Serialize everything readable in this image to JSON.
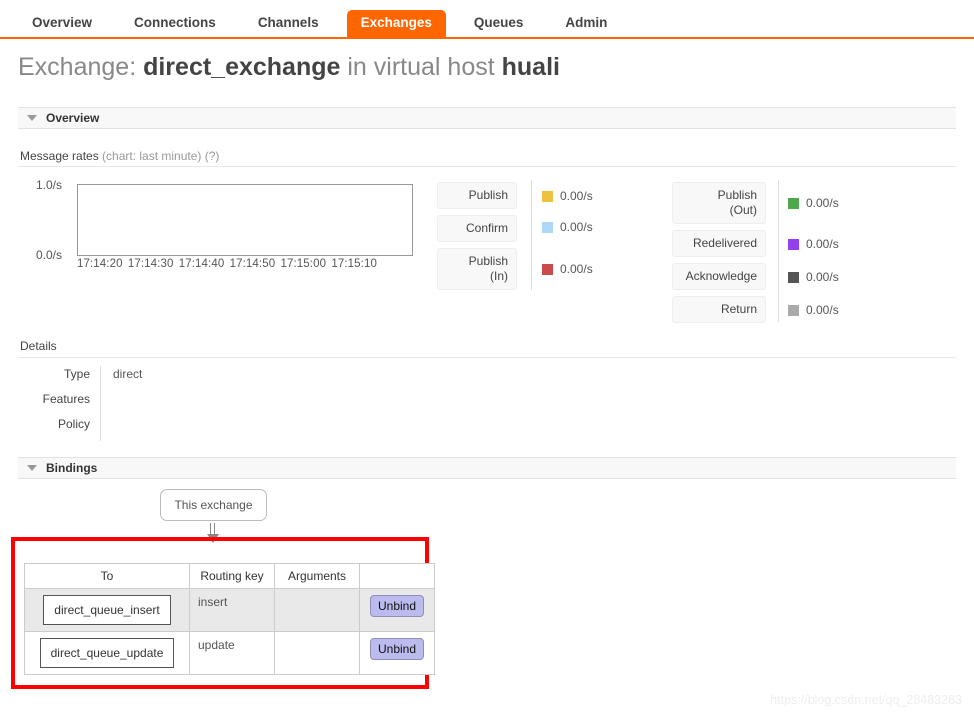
{
  "nav": {
    "items": [
      {
        "id": "overview",
        "label": "Overview",
        "active": false
      },
      {
        "id": "connections",
        "label": "Connections",
        "active": false
      },
      {
        "id": "channels",
        "label": "Channels",
        "active": false
      },
      {
        "id": "exchanges",
        "label": "Exchanges",
        "active": true
      },
      {
        "id": "queues",
        "label": "Queues",
        "active": false
      },
      {
        "id": "admin",
        "label": "Admin",
        "active": false
      }
    ],
    "accent_color": "#ff6600"
  },
  "page": {
    "title_prefix": "Exchange:",
    "exchange_name": "direct_exchange",
    "title_middle": "in virtual host",
    "vhost": "huali"
  },
  "overview_section": {
    "label": "Overview",
    "caret": "caret-down-icon",
    "message_rates_label": "Message rates",
    "message_rates_note": "(chart: last minute) (?)"
  },
  "chart_data": {
    "type": "line",
    "title": "Message rates (chart: last minute)",
    "xlabel": "",
    "ylabel": "",
    "ylim": [
      0.0,
      1.0
    ],
    "ytick_labels": [
      "1.0/s",
      "0.0/s"
    ],
    "ytick_values": [
      1.0,
      0.0
    ],
    "xtick_labels": [
      "17:14:20",
      "17:14:30",
      "17:14:40",
      "17:14:50",
      "17:15:00",
      "17:15:10"
    ],
    "grid": false,
    "legend_position": "right",
    "series": [
      {
        "name": "Publish",
        "color": "#edc240",
        "value": "0.00/s",
        "values": [
          0,
          0,
          0,
          0,
          0,
          0
        ]
      },
      {
        "name": "Confirm",
        "color": "#afd8f8",
        "value": "0.00/s",
        "values": [
          0,
          0,
          0,
          0,
          0,
          0
        ]
      },
      {
        "name": "Publish (In)",
        "color": "#cb4b4b",
        "value": "0.00/s",
        "values": [
          0,
          0,
          0,
          0,
          0,
          0
        ]
      },
      {
        "name": "Publish (Out)",
        "color": "#4da74d",
        "value": "0.00/s",
        "values": [
          0,
          0,
          0,
          0,
          0,
          0
        ]
      },
      {
        "name": "Redelivered",
        "color": "#9440ed",
        "value": "0.00/s",
        "values": [
          0,
          0,
          0,
          0,
          0,
          0
        ]
      },
      {
        "name": "Acknowledge",
        "color": "#555555",
        "value": "0.00/s",
        "values": [
          0,
          0,
          0,
          0,
          0,
          0
        ]
      },
      {
        "name": "Return",
        "color": "#aaaaaa",
        "value": "0.00/s",
        "values": [
          0,
          0,
          0,
          0,
          0,
          0
        ]
      }
    ]
  },
  "rates_left": [
    {
      "label": "Publish",
      "value": "0.00/s",
      "color": "#edc240",
      "two_line": false
    },
    {
      "label": "Confirm",
      "value": "0.00/s",
      "color": "#afd8f8",
      "two_line": false
    },
    {
      "label_1": "Publish",
      "label_2": "(In)",
      "label": "Publish\n(In)",
      "value": "0.00/s",
      "color": "#cb4b4b",
      "two_line": true
    }
  ],
  "rates_right": [
    {
      "label_1": "Publish",
      "label_2": "(Out)",
      "label": "Publish\n(Out)",
      "value": "0.00/s",
      "color": "#4da74d",
      "two_line": true
    },
    {
      "label": "Redelivered",
      "value": "0.00/s",
      "color": "#9440ed",
      "two_line": false
    },
    {
      "label": "Acknowledge",
      "value": "0.00/s",
      "color": "#555555",
      "two_line": false
    },
    {
      "label": "Return",
      "value": "0.00/s",
      "color": "#aaaaaa",
      "two_line": false
    }
  ],
  "details": {
    "heading": "Details",
    "rows": [
      {
        "key": "Type",
        "value": "direct"
      },
      {
        "key": "Features",
        "value": ""
      },
      {
        "key": "Policy",
        "value": ""
      }
    ]
  },
  "bindings_section": {
    "label": "Bindings",
    "caret": "caret-down-icon",
    "this_exchange_label": "This exchange",
    "arrow": "down-arrow-icon",
    "table": {
      "headers": [
        "To",
        "Routing key",
        "Arguments",
        ""
      ],
      "rows": [
        {
          "to": "direct_queue_insert",
          "routing_key": "insert",
          "arguments": "",
          "action": "Unbind"
        },
        {
          "to": "direct_queue_update",
          "routing_key": "update",
          "arguments": "",
          "action": "Unbind"
        }
      ]
    }
  },
  "highlight": {
    "color": "#ff0000"
  },
  "watermark": {
    "text": "https://blog.csdn.net/qq_28483283"
  }
}
